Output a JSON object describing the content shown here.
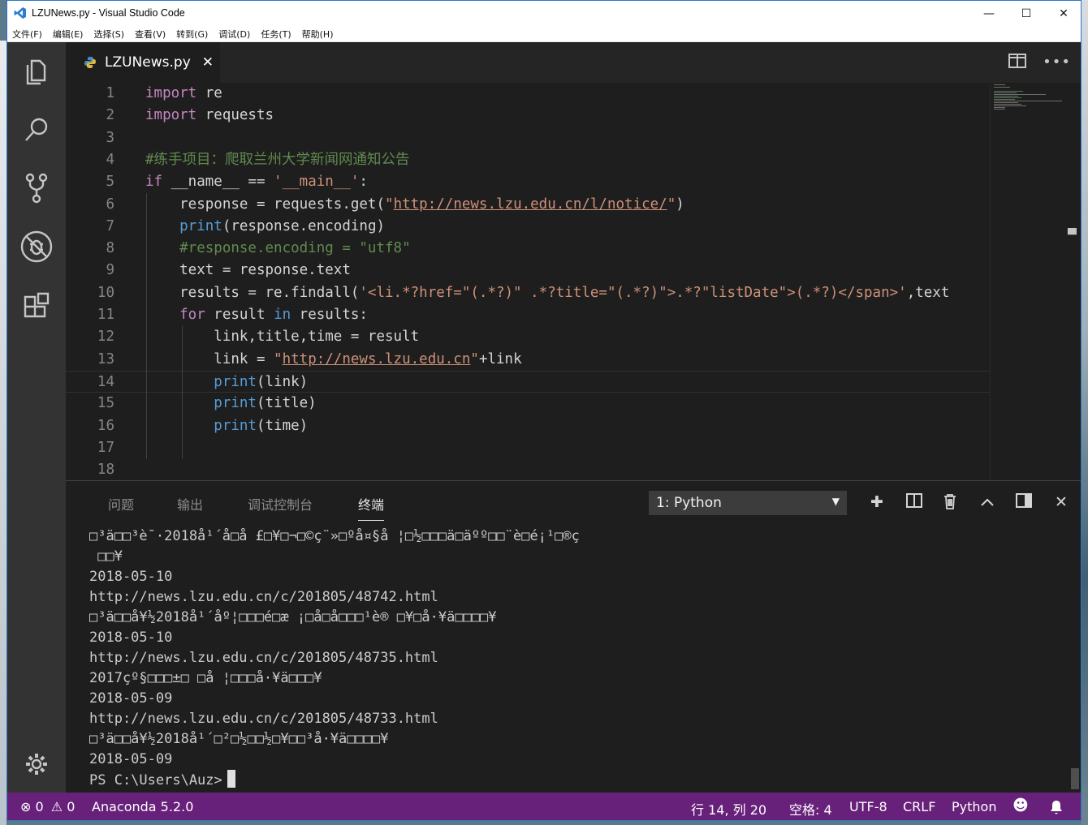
{
  "window": {
    "title": "LZUNews.py - Visual Studio Code",
    "controls": [
      "minimize",
      "maximize",
      "close"
    ]
  },
  "menu": [
    "文件(F)",
    "编辑(E)",
    "选择(S)",
    "查看(V)",
    "转到(G)",
    "调试(D)",
    "任务(T)",
    "帮助(H)"
  ],
  "activity_bar": {
    "icons": [
      "files-icon",
      "search-icon",
      "source-control-icon",
      "debug-icon",
      "extensions-icon"
    ],
    "bottom_icon": "gear-icon"
  },
  "tab": {
    "filename": "LZUNews.py",
    "close_glyph": "✕"
  },
  "editor": {
    "lines": [
      {
        "n": "1",
        "tokens": [
          [
            "kw2",
            "import"
          ],
          [
            "plain",
            " re"
          ]
        ]
      },
      {
        "n": "2",
        "tokens": [
          [
            "kw2",
            "import"
          ],
          [
            "plain",
            " requests"
          ]
        ]
      },
      {
        "n": "3",
        "tokens": []
      },
      {
        "n": "4",
        "tokens": [
          [
            "cmt",
            "#练手项目：爬取兰州大学新闻网通知公告"
          ]
        ]
      },
      {
        "n": "5",
        "tokens": [
          [
            "kw2",
            "if"
          ],
          [
            "plain",
            " __name__ == "
          ],
          [
            "str",
            "'__main__'"
          ],
          [
            "plain",
            ":"
          ]
        ]
      },
      {
        "n": "6",
        "tokens": [
          [
            "plain",
            "    response = requests.get("
          ],
          [
            "str",
            "\""
          ],
          [
            "url",
            "http://news.lzu.edu.cn/l/notice/"
          ],
          [
            "str",
            "\""
          ],
          [
            "plain",
            ")"
          ]
        ]
      },
      {
        "n": "7",
        "tokens": [
          [
            "fn",
            "    print"
          ],
          [
            "plain",
            "(response.encoding)"
          ]
        ]
      },
      {
        "n": "8",
        "tokens": [
          [
            "cmt",
            "    #response.encoding = \"utf8\""
          ]
        ]
      },
      {
        "n": "9",
        "tokens": [
          [
            "plain",
            "    text = response.text"
          ]
        ]
      },
      {
        "n": "10",
        "tokens": [
          [
            "plain",
            "    results = re.findall("
          ],
          [
            "str",
            "'<li.*?href=\"(.*?)\" .*?title=\"(.*?)\">.*?\"listDate\">(.*?)</span>'"
          ],
          [
            "plain",
            ",text"
          ]
        ]
      },
      {
        "n": "11",
        "tokens": [
          [
            "kw2",
            "    for"
          ],
          [
            "plain",
            " result "
          ],
          [
            "kw",
            "in"
          ],
          [
            "plain",
            " results:"
          ]
        ]
      },
      {
        "n": "12",
        "tokens": [
          [
            "plain",
            "        link,title,time = result"
          ]
        ]
      },
      {
        "n": "13",
        "tokens": [
          [
            "plain",
            "        link = "
          ],
          [
            "str",
            "\""
          ],
          [
            "url",
            "http://news.lzu.edu.cn"
          ],
          [
            "str",
            "\""
          ],
          [
            "plain",
            "+link"
          ]
        ]
      },
      {
        "n": "14",
        "tokens": [
          [
            "fn",
            "        print"
          ],
          [
            "plain",
            "(link)"
          ]
        ]
      },
      {
        "n": "15",
        "tokens": [
          [
            "fn",
            "        print"
          ],
          [
            "plain",
            "(title)"
          ]
        ]
      },
      {
        "n": "16",
        "tokens": [
          [
            "fn",
            "        print"
          ],
          [
            "plain",
            "(time)"
          ]
        ]
      },
      {
        "n": "17",
        "tokens": []
      },
      {
        "n": "18",
        "tokens": []
      }
    ],
    "current_line": 14
  },
  "panel": {
    "tabs": [
      "问题",
      "输出",
      "调试控制台",
      "终端"
    ],
    "active_tab": "终端",
    "terminal_select": "1: Python",
    "terminal_lines": [
      "□³ä□□³è¯·2018å¹´å□å £□¥□¬□©ç¨»□ºå¤§å ¦□½□□□ä□äºº□□¨è□é¡¹□®ç",
      " □□¥",
      "2018-05-10",
      "http://news.lzu.edu.cn/c/201805/48742.html",
      "□³ä□□å¥½2018å¹´åº¦□□□é□æ ¡□å□å□□□¹è® □¥□å·¥ä□□□□¥",
      "2018-05-10",
      "http://news.lzu.edu.cn/c/201805/48735.html",
      "2017çº§□□□±□ □å ¦□□□å·¥ä□□□¥",
      "2018-05-09",
      "http://news.lzu.edu.cn/c/201805/48733.html",
      "□³ä□□å¥½2018å¹´□²□½□□½□¥□□³å·¥ä□□□□¥",
      "2018-05-09",
      "PS C:\\Users\\Auz>"
    ]
  },
  "statusbar": {
    "errors": "0",
    "warnings": "0",
    "interpreter": "Anaconda 5.2.0",
    "position": "行 14, 列 20",
    "indent": "空格: 4",
    "encoding": "UTF-8",
    "eol": "CRLF",
    "language": "Python"
  },
  "colors": {
    "statusbar": "#68217a",
    "activity_bar": "#333333",
    "editor_bg": "#1e1e1e",
    "keyword": "#c586c0",
    "builtin": "#569cd6",
    "string": "#ce9178",
    "comment": "#608b4e"
  }
}
